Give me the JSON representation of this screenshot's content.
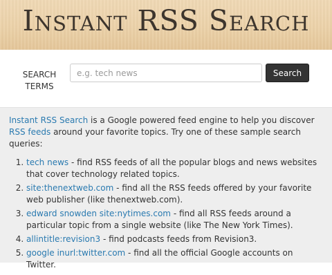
{
  "header": {
    "title": "Instant RSS Search"
  },
  "search": {
    "label": "SEARCH TERMS",
    "placeholder": "e.g. tech news",
    "value": "",
    "button_label": "Search"
  },
  "info": {
    "intro": {
      "app_link": "Instant RSS Search",
      "text_1": " is a Google powered feed engine to help you discover ",
      "feeds_link": "RSS feeds",
      "text_2": " around your favorite topics. Try one of these sample search queries:"
    },
    "queries": [
      {
        "number": "1.",
        "query": "tech news",
        "description": " - find RSS feeds of all the popular blogs and news websites that cover technology related topics."
      },
      {
        "number": "2.",
        "query": "site:thenextweb.com",
        "description": " - find all the RSS feeds offered by your favorite web publisher (like thenextweb.com)."
      },
      {
        "number": "3.",
        "query": "edward snowden site:nytimes.com",
        "description": " - find all RSS feeds around a particular topic from a single website (like The New York Times)."
      },
      {
        "number": "4.",
        "query": "allintitle:revision3",
        "description": " - find podcasts feeds from Revision3."
      },
      {
        "number": "5.",
        "query": "google inurl:twitter.com",
        "description": " - find all the official Google accounts on Twitter."
      }
    ]
  },
  "colors": {
    "header_bg": "#ecd2a9",
    "title_text": "#3d352d",
    "link": "#2a7ab0",
    "button_bg": "#333333",
    "panel_bg": "#eeeeee"
  }
}
